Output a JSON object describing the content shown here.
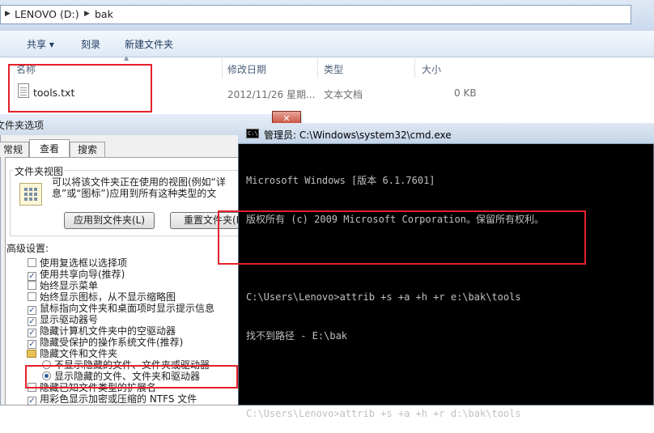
{
  "explorer": {
    "breadcrumb": [
      "LENOVO (D:)",
      "bak"
    ],
    "toolbar": {
      "share": "共享 ▾",
      "burn": "刻录",
      "new_folder": "新建文件夹"
    },
    "columns": {
      "name": "名称",
      "modified": "修改日期",
      "type": "类型",
      "size": "大小"
    },
    "files": [
      {
        "name": "tools.txt",
        "modified": "2012/11/26 星期...",
        "type": "文本文档",
        "size": "0 KB"
      }
    ]
  },
  "folder_options": {
    "title": "文件夹选项",
    "tabs": [
      "常规",
      "查看",
      "搜索"
    ],
    "active_tab": 1,
    "folder_views": {
      "title": "文件夹视图",
      "desc_line1": "可以将该文件夹正在使用的视图(例如“详",
      "desc_line2": "息”或“图标”)应用到所有这种类型的文",
      "apply_button": "应用到文件夹(L)",
      "reset_button": "重置文件夹(R)"
    },
    "advanced_title": "高级设置:",
    "settings": [
      {
        "kind": "checkbox",
        "checked": false,
        "label": "使用复选框以选择项"
      },
      {
        "kind": "checkbox",
        "checked": true,
        "label": "使用共享向导(推荐)"
      },
      {
        "kind": "checkbox",
        "checked": false,
        "label": "始终显示菜单"
      },
      {
        "kind": "checkbox",
        "checked": false,
        "label": "始终显示图标，从不显示缩略图"
      },
      {
        "kind": "checkbox",
        "checked": true,
        "label": "鼠标指向文件夹和桌面项时显示提示信息"
      },
      {
        "kind": "checkbox",
        "checked": true,
        "label": "显示驱动器号"
      },
      {
        "kind": "checkbox",
        "checked": true,
        "label": "隐藏计算机文件夹中的空驱动器"
      },
      {
        "kind": "checkbox",
        "checked": true,
        "label": "隐藏受保护的操作系统文件(推荐)"
      },
      {
        "kind": "folder",
        "label": "隐藏文件和文件夹"
      },
      {
        "kind": "radio",
        "checked": false,
        "label": "不显示隐藏的文件、文件夹或驱动器"
      },
      {
        "kind": "radio",
        "checked": true,
        "label": "显示隐藏的文件、文件夹和驱动器"
      },
      {
        "kind": "checkbox",
        "checked": false,
        "label": "隐藏已知文件类型的扩展名"
      },
      {
        "kind": "checkbox",
        "checked": true,
        "label": "用彩色显示加密或压缩的 NTFS 文件"
      }
    ],
    "close_glyph": "✕"
  },
  "cmd": {
    "title": "管理员: C:\\Windows\\system32\\cmd.exe",
    "icon_text": "C:\\",
    "lines": [
      "Microsoft Windows [版本 6.1.7601]",
      "版权所有 (c) 2009 Microsoft Corporation。保留所有权利。",
      "",
      "C:\\Users\\Lenovo>attrib +s +a +h +r e:\\bak\\tools",
      "找不到路径 - E:\\bak",
      "",
      "C:\\Users\\Lenovo>attrib +s +a +h +r d:\\bak\\tools"
    ]
  },
  "colors": {
    "highlight_box": "#e5202b",
    "cmd_background": "#000000",
    "cmd_text": "#c0c0c0"
  }
}
